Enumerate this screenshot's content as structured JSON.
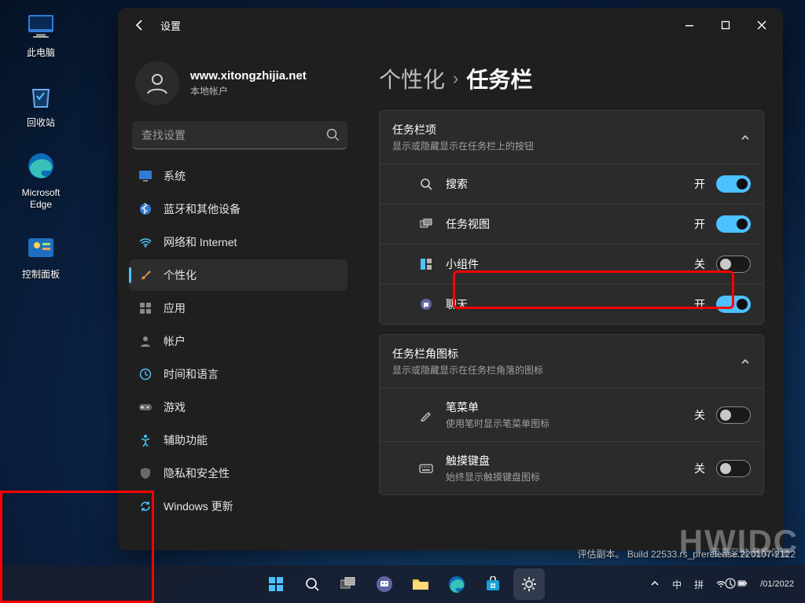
{
  "desktop_icons": {
    "this_pc": "此电脑",
    "recycle_bin": "回收站",
    "edge": "Microsoft Edge",
    "control_panel": "控制面板"
  },
  "window": {
    "title": "设置",
    "account": {
      "name": "www.xitongzhijia.net",
      "type": "本地帐户"
    },
    "search_placeholder": "查找设置",
    "nav": {
      "system": "系统",
      "bluetooth": "蓝牙和其他设备",
      "network": "网络和 Internet",
      "personalization": "个性化",
      "apps": "应用",
      "accounts": "帐户",
      "time_language": "时间和语言",
      "gaming": "游戏",
      "accessibility": "辅助功能",
      "privacy": "隐私和安全性",
      "update": "Windows 更新"
    },
    "breadcrumb": {
      "parent": "个性化",
      "current": "任务栏"
    },
    "sections": {
      "items": {
        "title": "任务栏项",
        "subtitle": "显示或隐藏显示在任务栏上的按钮"
      },
      "corner": {
        "title": "任务栏角图标",
        "subtitle": "显示或隐藏显示在任务栏角落的图标"
      }
    },
    "rows": {
      "search": "搜索",
      "task_view": "任务视图",
      "widgets": "小组件",
      "chat": "聊天",
      "pen": {
        "label": "笔菜单",
        "sub": "使用笔时显示笔菜单图标"
      },
      "touch_kbd": {
        "label": "触摸键盘",
        "sub": "始终显示触摸键盘图标"
      }
    },
    "states": {
      "on": "开",
      "off": "关"
    }
  },
  "tray": {
    "ime_lang": "中",
    "ime_mode": "拼"
  },
  "clock": {
    "time": "",
    "date": "/01/2022"
  },
  "build": "评估副本。  Build 22533.rs_prerelease.220107-2122",
  "watermark": "HWIDC",
  "watermark2": "至真至诚 品质保证"
}
